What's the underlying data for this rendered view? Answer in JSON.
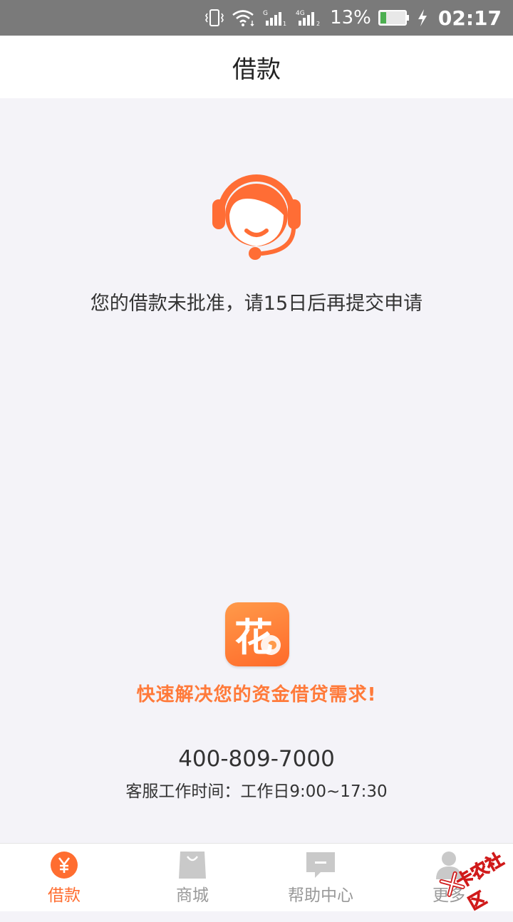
{
  "status_bar": {
    "battery_percent": "13%",
    "time": "02:17",
    "signal_1_label": "G",
    "signal_2_label": "4G",
    "icons": [
      "vibrate-icon",
      "wifi-icon",
      "signal-icon",
      "signal-4g-icon",
      "battery-icon",
      "charging-icon"
    ]
  },
  "header": {
    "title": "借款"
  },
  "main": {
    "message": "您的借款未批准，请15日后再提交申请",
    "logo_char": "花",
    "slogan": "快速解决您的资金借贷需求!",
    "phone": "400-809-7000",
    "service_hours": "客服工作时间：工作日9:00~17:30"
  },
  "tabs": [
    {
      "label": "借款",
      "icon": "yuan-icon",
      "active": true
    },
    {
      "label": "商城",
      "icon": "shopping-bag-icon",
      "active": false
    },
    {
      "label": "帮助中心",
      "icon": "chat-bubble-icon",
      "active": false
    },
    {
      "label": "更多",
      "icon": "person-icon",
      "active": false
    }
  ],
  "watermark": {
    "text": "卡农社区"
  },
  "colors": {
    "accent": "#ff6d30",
    "background": "#f4f3f8",
    "status_bar": "#7a7a7a"
  }
}
